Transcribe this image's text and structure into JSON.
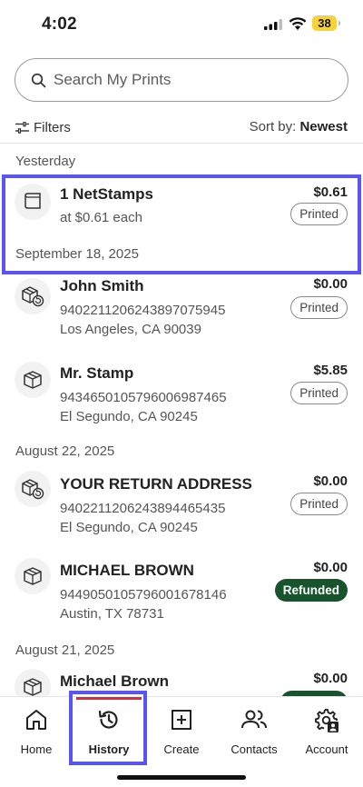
{
  "status": {
    "time": "4:02",
    "battery": "38"
  },
  "search": {
    "placeholder": "Search My Prints"
  },
  "toolbar": {
    "filters_label": "Filters",
    "sort_label": "Sort by:",
    "sort_value": "Newest"
  },
  "groups": [
    {
      "date": "Yesterday"
    },
    {
      "date": "August 22, 2025"
    },
    {
      "date": "August 21, 2025"
    }
  ],
  "items": [
    {
      "icon": "netstamps-roll-icon",
      "title": "1 NetStamps",
      "line1": "at $0.61 each",
      "line2": "September 18, 2025",
      "amount": "$0.61",
      "status": "Printed"
    },
    {
      "icon": "return-package-icon",
      "title": "John Smith",
      "line1": "9402211206243897075945",
      "line2": "Los Angeles, CA 90039",
      "amount": "$0.00",
      "status": "Printed"
    },
    {
      "icon": "package-icon",
      "title": "Mr. Stamp",
      "line1": "9434650105796006987465",
      "line2": "El Segundo, CA 90245",
      "amount": "$5.85",
      "status": "Printed"
    },
    {
      "icon": "return-package-icon",
      "title": "YOUR RETURN ADDRESS",
      "line1": "9402211206243894465435",
      "line2": "El Segundo, CA 90245",
      "amount": "$0.00",
      "status": "Printed"
    },
    {
      "icon": "package-icon",
      "title": "MICHAEL BROWN",
      "line1": "9449050105796001678146",
      "line2": "Austin, TX 78731",
      "amount": "$0.00",
      "status": "Refunded"
    },
    {
      "icon": "package-icon",
      "title": "Michael Brown",
      "amount": "$0.00"
    }
  ],
  "nav": {
    "items": [
      {
        "label": "Home",
        "icon": "home-icon"
      },
      {
        "label": "History",
        "icon": "history-icon",
        "active": true
      },
      {
        "label": "Create",
        "icon": "create-icon"
      },
      {
        "label": "Contacts",
        "icon": "contacts-icon"
      },
      {
        "label": "Account",
        "icon": "account-settings-icon"
      }
    ]
  },
  "colors": {
    "highlight": "#5a54f2",
    "refunded": "#17532c",
    "active_tab": "#e02b3a"
  }
}
